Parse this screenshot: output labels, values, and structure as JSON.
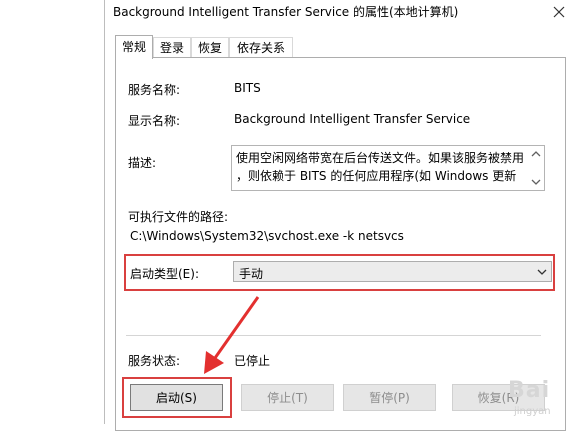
{
  "window": {
    "title": "Background Intelligent Transfer Service 的属性(本地计算机)",
    "close_icon": "close-icon"
  },
  "tabs": [
    {
      "label": "常规",
      "active": true
    },
    {
      "label": "登录",
      "active": false
    },
    {
      "label": "恢复",
      "active": false
    },
    {
      "label": "依存关系",
      "active": false
    }
  ],
  "general": {
    "service_name_label": "服务名称:",
    "service_name_value": "BITS",
    "display_name_label": "显示名称:",
    "display_name_value": "Background Intelligent Transfer Service",
    "description_label": "描述:",
    "description_line1": "使用空闲网络带宽在后台传送文件。如果该服务被禁用",
    "description_line2": "，则依赖于 BITS 的任何应用程序(如 Windows 更新",
    "exe_path_label": "可执行文件的路径:",
    "exe_path_value": "C:\\Windows\\System32\\svchost.exe -k netsvcs",
    "startup_type_label": "启动类型(E):",
    "startup_type_value": "手动",
    "service_status_label": "服务状态:",
    "service_status_value": "已停止"
  },
  "buttons": {
    "start": "启动(S)",
    "stop": "停止(T)",
    "pause": "暂停(P)",
    "resume": "恢复(R)"
  },
  "watermark": {
    "text": "Bai",
    "sub": "jingyan"
  },
  "colors": {
    "highlight": "#d9403f",
    "panel_border": "#adadad"
  }
}
